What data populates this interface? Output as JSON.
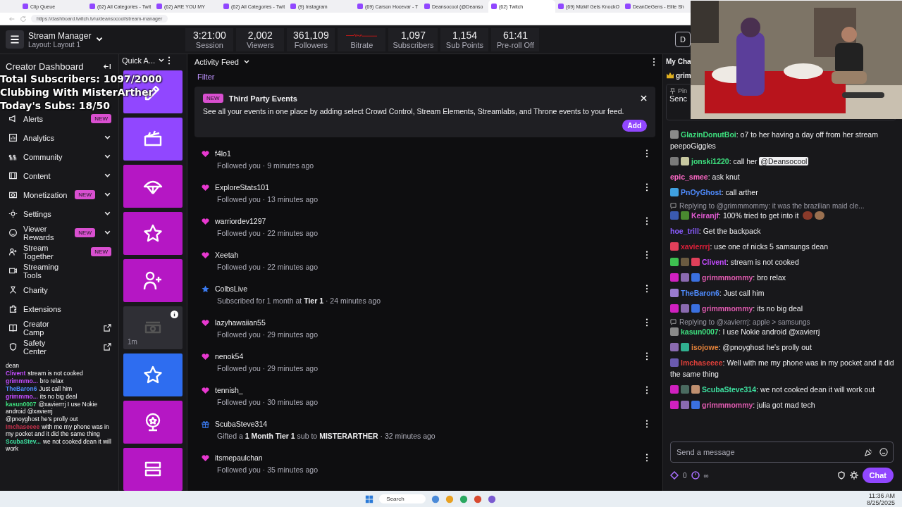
{
  "browser": {
    "tabs": [
      {
        "title": "Clip Queue",
        "selected": false
      },
      {
        "title": "(62) All Categories - Twit",
        "selected": false
      },
      {
        "title": "(62) ARE YOU MY",
        "selected": false
      },
      {
        "title": "(62) All Categories - Twit",
        "selected": false
      },
      {
        "title": "(9) Instagram",
        "selected": false
      },
      {
        "title": "(69) Carson Hocevar - T",
        "selected": false
      },
      {
        "title": "Deansocool (@Deanso",
        "selected": false
      },
      {
        "title": "(62) Twitch",
        "selected": true
      },
      {
        "title": "(69) Mizkif Gets KnockO",
        "selected": false
      },
      {
        "title": "DeanDeGens - Elite Sh",
        "selected": false
      }
    ],
    "address": "https://dashboard.twitch.tv/u/deansocool/stream-manager"
  },
  "topbar": {
    "title": "Stream Manager",
    "layout": "Layout: Layout 1",
    "stats": [
      {
        "kind": "number",
        "value": "3:21:00",
        "label": "Session"
      },
      {
        "kind": "number",
        "value": "2,002",
        "label": "Viewers"
      },
      {
        "kind": "number",
        "value": "361,109",
        "label": "Followers"
      },
      {
        "kind": "graph",
        "label": "Bitrate"
      },
      {
        "kind": "number",
        "value": "1,097",
        "label": "Subscribers"
      },
      {
        "kind": "number",
        "value": "1,154",
        "label": "Sub Points"
      },
      {
        "kind": "number",
        "value": "61:41",
        "label": "Pre-roll Off"
      }
    ],
    "button": "D"
  },
  "sidebar": {
    "title": "Creator Dashboard",
    "items": [
      {
        "label": "Alerts",
        "badge": "NEW",
        "expandable": false,
        "external": false
      },
      {
        "label": "Analytics",
        "expandable": true,
        "external": false
      },
      {
        "label": "Community",
        "expandable": true,
        "external": false
      },
      {
        "label": "Content",
        "expandable": true,
        "external": false
      },
      {
        "label": "Monetization",
        "badge": "NEW",
        "expandable": true,
        "external": false
      },
      {
        "label": "Settings",
        "expandable": true,
        "external": false
      },
      {
        "label": "Viewer Rewards",
        "badge": "NEW",
        "expandable": true,
        "external": false
      },
      {
        "label": "Stream Together",
        "badge": "NEW",
        "expandable": false,
        "external": false
      },
      {
        "label": "Streaming Tools",
        "expandable": false,
        "external": false
      },
      {
        "label": "Charity",
        "expandable": false,
        "external": false
      },
      {
        "label": "Extensions",
        "expandable": false,
        "external": false
      },
      {
        "label": "Creator Camp",
        "expandable": false,
        "external": true
      },
      {
        "label": "Safety Center",
        "expandable": false,
        "external": true
      }
    ]
  },
  "overlay": {
    "lines": [
      "Total Subscribers: 1097/2000",
      "Clubbing With MisterArther",
      "Today's Subs: 18/50"
    ],
    "chat": [
      {
        "text": "dean"
      },
      {
        "name": "Clivent",
        "color": "#c44cff",
        "text": "stream is not cooked"
      },
      {
        "name": "grimmmo...",
        "color": "#c44cff",
        "text": "bro relax"
      },
      {
        "name": "TheBaron6",
        "color": "#4f8cff",
        "text": "Just call him"
      },
      {
        "name": "grimmmo...",
        "color": "#c44cff",
        "text": "its no big deal"
      },
      {
        "name": "kasun0007",
        "color": "#3ee07f",
        "text": "@xavierrrj I use Nokie android @xavierrj"
      },
      {
        "text": "@pnoyghost he's prolly out"
      },
      {
        "name": "Imchaseeee",
        "color": "#c0304a",
        "text": "with me my phone was in my pocket and it did the same thing"
      },
      {
        "name": "ScubaStev...",
        "color": "#3ee0a0",
        "text": "we not cooked dean it will work"
      }
    ]
  },
  "quick_actions": {
    "title": "Quick A...",
    "tiles": [
      {
        "color": "#9147ff",
        "disabled": false
      },
      {
        "color": "#9147ff",
        "disabled": false
      },
      {
        "color": "#b517c4",
        "disabled": false
      },
      {
        "color": "#b517c4",
        "disabled": false
      },
      {
        "color": "#b517c4",
        "disabled": false
      },
      {
        "color": "#2f2f35",
        "disabled": true,
        "timer": "1m"
      },
      {
        "color": "#2e6df0",
        "disabled": false
      },
      {
        "color": "#b517c4",
        "disabled": false
      },
      {
        "color": "#b517c4",
        "disabled": false
      }
    ]
  },
  "activity_feed": {
    "title": "Activity Feed",
    "filter": "Filter",
    "notice": {
      "badge": "NEW",
      "title": "Third Party Events",
      "text": "See all your events in one place by adding select Crowd Control, Stream Elements, Streamlabs, and Throne events to your feed.",
      "button": "Add"
    },
    "events": [
      {
        "kind": "follow",
        "name": "f4lo1",
        "detail": "Followed you · 9 minutes ago"
      },
      {
        "kind": "follow",
        "name": "ExploreStats101",
        "detail": "Followed you · 13 minutes ago"
      },
      {
        "kind": "follow",
        "name": "warriordev1297",
        "detail": "Followed you · 22 minutes ago"
      },
      {
        "kind": "follow",
        "name": "Xeetah",
        "detail": "Followed you · 22 minutes ago"
      },
      {
        "kind": "sub",
        "name": "ColbsLive",
        "detail": "Subscribed for 1 month at **Tier 1** · 24 minutes ago"
      },
      {
        "kind": "follow",
        "name": "lazyhawaiian55",
        "detail": "Followed you · 29 minutes ago"
      },
      {
        "kind": "follow",
        "name": "nenok54",
        "detail": "Followed you · 29 minutes ago"
      },
      {
        "kind": "follow",
        "name": "tennish_",
        "detail": "Followed you · 30 minutes ago"
      },
      {
        "kind": "gift",
        "name": "ScubaSteve314",
        "detail": "Gifted a **1 Month Tier 1** sub to **MISTERARTHER** · 32 minutes ago"
      },
      {
        "kind": "follow",
        "name": "itsmepaulchan",
        "detail": "Followed you · 35 minutes ago"
      }
    ]
  },
  "chat": {
    "title": "My Cha",
    "top_name": "grim",
    "pinned": {
      "label": "Pin",
      "text": "Senc"
    },
    "messages": [
      {
        "name": "GlazinDonutBoi",
        "color": "#3ee07f",
        "text": ": o7 to her having a day off from her stream peepoGiggles",
        "badges": [
          {
            "color": "#8a8a8a"
          }
        ]
      },
      {
        "name": "jonski1220",
        "color": "#3ee07f",
        "text": ": call her",
        "mention": "@Deansocool",
        "badges": [
          {
            "color": "#7a7a7a"
          },
          {
            "color": "#c8c8a0"
          }
        ]
      },
      {
        "name": "epic_smee",
        "color": "#ff69c8",
        "text": ": ask knut"
      },
      {
        "name": "PnOyGhost",
        "color": "#4f8cff",
        "text": ": call arther",
        "badges": [
          {
            "color": "#3fa0e0"
          }
        ]
      },
      {
        "reply": "Replying to @grimmmommy: it was the brazilian maid cle...",
        "name": "Keiranjf",
        "color": "#e05ad0",
        "text": ": 100% tried to get into it",
        "emotes": true,
        "badges": [
          {
            "color": "#3a5ab0"
          },
          {
            "color": "#4a8a30"
          }
        ]
      },
      {
        "name": "hoe_trill",
        "color": "#8a5cff",
        "text": ": Get the backpack"
      },
      {
        "name": "xavierrrj",
        "color": "#e0203a",
        "text": ": use one of nicks 5 samsungs dean",
        "badges": [
          {
            "color": "#e0405a"
          }
        ]
      },
      {
        "name": "Clivent",
        "color": "#c44cff",
        "text": ": stream is not cooked",
        "badges": [
          {
            "color": "#3ec050"
          },
          {
            "color": "#6a5a40"
          },
          {
            "color": "#e0405a"
          }
        ]
      },
      {
        "name": "grimmmommy",
        "color": "#e05ab0",
        "text": ": bro relax",
        "badges": [
          {
            "color": "#d020c0"
          },
          {
            "color": "#8a6ab0"
          },
          {
            "color": "#3a70e0"
          }
        ]
      },
      {
        "name": "TheBaron6",
        "color": "#4f8cff",
        "text": ": Just call him",
        "badges": [
          {
            "color": "#9a7ad0"
          }
        ]
      },
      {
        "name": "grimmmommy",
        "color": "#e05ab0",
        "text": ": its no big deal",
        "badges": [
          {
            "color": "#d020c0"
          },
          {
            "color": "#8a6ab0"
          },
          {
            "color": "#3a70e0"
          }
        ]
      },
      {
        "reply": "Replying to @xavierrrj: apple > samsungs",
        "name": "kasun0007",
        "color": "#3ee07f",
        "text": ": I use Nokie android @xavierrj",
        "badges": [
          {
            "color": "#8a8a8a"
          }
        ]
      },
      {
        "name": "isojowe",
        "color": "#e0803a",
        "text": ": @pnoyghost he's prolly out",
        "badges": [
          {
            "color": "#8a6ab0"
          },
          {
            "color": "#30b090"
          }
        ]
      },
      {
        "name": "Imchaseeee",
        "color": "#e0403a",
        "text": ": Well with me my phone was in my pocket and it did the same thing",
        "badges": [
          {
            "color": "#6a5ab0"
          }
        ]
      },
      {
        "name": "ScubaSteve314",
        "color": "#3ee0a0",
        "text": ": we not cooked dean it will work out",
        "badges": [
          {
            "color": "#d020c0"
          },
          {
            "color": "#4a6a60"
          },
          {
            "color": "#c09070"
          }
        ]
      },
      {
        "name": "grimmmommy",
        "color": "#e05ab0",
        "text": ": julia got mad tech",
        "badges": [
          {
            "color": "#d020c0"
          },
          {
            "color": "#8a6ab0"
          },
          {
            "color": "#3a70e0"
          }
        ]
      }
    ],
    "placeholder": "Send a message",
    "points": "0",
    "infinity": "∞",
    "button": "Chat"
  },
  "taskbar": {
    "search": "Search",
    "time": "11:36 AM",
    "date": "8/25/2025"
  }
}
